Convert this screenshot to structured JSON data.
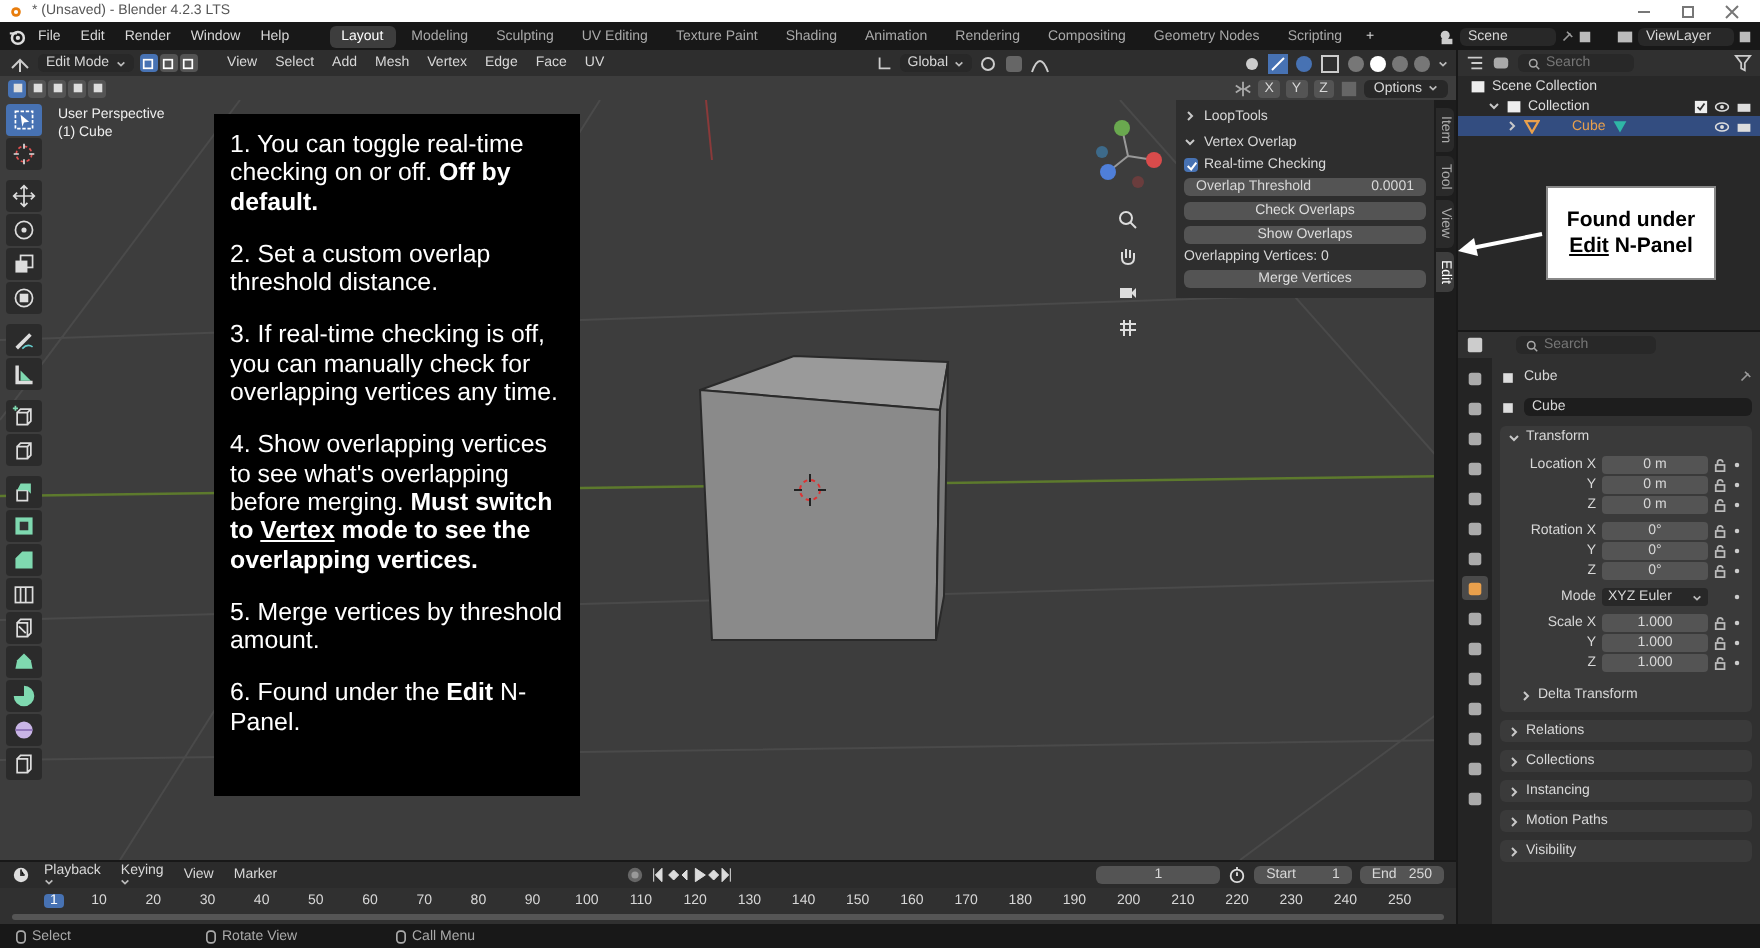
{
  "window": {
    "title": "* (Unsaved) - Blender 4.2.3 LTS"
  },
  "menu": [
    "File",
    "Edit",
    "Render",
    "Window",
    "Help"
  ],
  "workspaces": [
    {
      "label": "Layout",
      "selected": true
    },
    {
      "label": "Modeling",
      "selected": false
    },
    {
      "label": "Sculpting",
      "selected": false
    },
    {
      "label": "UV Editing",
      "selected": false
    },
    {
      "label": "Texture Paint",
      "selected": false
    },
    {
      "label": "Shading",
      "selected": false
    },
    {
      "label": "Animation",
      "selected": false
    },
    {
      "label": "Rendering",
      "selected": false
    },
    {
      "label": "Compositing",
      "selected": false
    },
    {
      "label": "Geometry Nodes",
      "selected": false
    },
    {
      "label": "Scripting",
      "selected": false
    }
  ],
  "add_workspace": "+",
  "scene": "Scene",
  "view_layer": "ViewLayer",
  "viewport_header": {
    "mode": "Edit Mode",
    "select_modes": [
      {
        "selected": true
      },
      {
        "selected": false
      },
      {
        "selected": false
      }
    ],
    "menus": [
      "View",
      "Select",
      "Add",
      "Mesh",
      "Vertex",
      "Edge",
      "Face",
      "UV"
    ],
    "orientation": "Global",
    "shading_modes": [
      {
        "selected": false
      },
      {
        "selected": true
      },
      {
        "selected": false
      },
      {
        "selected": false
      }
    ],
    "selection_ops": [
      {
        "selected": true
      },
      {
        "selected": false
      },
      {
        "selected": false
      },
      {
        "selected": false
      },
      {
        "selected": false
      }
    ],
    "mirror_axes": [
      "X",
      "Y",
      "Z"
    ],
    "options": "Options"
  },
  "viewport": {
    "view_name": "User Perspective",
    "object": "(1) Cube"
  },
  "tools": [
    {
      "selected": true
    },
    {
      "selected": false
    },
    {
      "selected": false
    },
    {
      "selected": false
    },
    {
      "selected": false
    },
    {
      "selected": false
    },
    {
      "selected": false
    },
    {
      "selected": false
    },
    {
      "selected": false
    },
    {
      "selected": false
    },
    {
      "selected": false
    },
    {
      "selected": false
    },
    {
      "selected": false
    },
    {
      "selected": false
    },
    {
      "selected": false
    },
    {
      "selected": false
    },
    {
      "selected": false
    },
    {
      "selected": false
    },
    {
      "selected": false
    }
  ],
  "instructions": [
    {
      "segments": [
        {
          "text": "1. You can toggle real-time checking on or off. ",
          "kind": "plain"
        },
        {
          "text": "Off by default.",
          "kind": "bold"
        }
      ]
    },
    {
      "segments": [
        {
          "text": "2. Set a custom overlap threshold distance.",
          "kind": "plain"
        }
      ]
    },
    {
      "segments": [
        {
          "text": "3. If real-time checking is off, you can manually check for overlapping vertices any time.",
          "kind": "plain"
        }
      ]
    },
    {
      "segments": [
        {
          "text": "4. Show overlapping vertices to see what's overlapping before merging. ",
          "kind": "plain"
        },
        {
          "text": "Must switch to ",
          "kind": "bold"
        },
        {
          "text": "Vertex",
          "kind": "underlined"
        },
        {
          "text": " mode to see the overlapping vertices.",
          "kind": "bold"
        }
      ]
    },
    {
      "segments": [
        {
          "text": "5. Merge vertices by threshold amount.",
          "kind": "plain"
        }
      ]
    },
    {
      "segments": [
        {
          "text": "6. Found under the ",
          "kind": "plain"
        },
        {
          "text": "Edit",
          "kind": "bold"
        },
        {
          "text": " N-Panel.",
          "kind": "plain"
        }
      ]
    }
  ],
  "n_panel": {
    "sections": [
      {
        "label": "LoopTools",
        "expanded": false
      },
      {
        "label": "Vertex Overlap",
        "expanded": true
      }
    ],
    "realtime": {
      "label": "Real-time Checking",
      "checked": true
    },
    "threshold": {
      "label": "Overlap Threshold",
      "value": "0.0001"
    },
    "buttons": [
      "Check Overlaps",
      "Show Overlaps"
    ],
    "count": "Overlapping Vertices: 0",
    "merge": "Merge Vertices",
    "tabs": [
      {
        "label": "Item",
        "selected": false
      },
      {
        "label": "Tool",
        "selected": false
      },
      {
        "label": "View",
        "selected": false
      },
      {
        "label": "Edit",
        "selected": true
      }
    ]
  },
  "callout": {
    "lines": [
      {
        "segments": [
          {
            "text": "Found under",
            "kind": "bold"
          }
        ]
      },
      {
        "segments": [
          {
            "text": "Edit",
            "kind": "underlined"
          },
          {
            "text": " N-Panel",
            "kind": "bold"
          }
        ]
      }
    ]
  },
  "outliner": {
    "search_placeholder": "Search",
    "items": [
      {
        "label": "Scene Collection",
        "kind": "scene_collection",
        "selected": false,
        "children": [
          {
            "label": "Collection",
            "kind": "collection",
            "selected": false,
            "expanded": true,
            "children": [
              {
                "label": "Cube",
                "kind": "mesh_object",
                "selected": true,
                "expanded": false
              }
            ]
          }
        ]
      }
    ]
  },
  "properties": {
    "search_placeholder": "Search",
    "tabs": [
      {
        "selected": false
      },
      {
        "selected": false
      },
      {
        "selected": false
      },
      {
        "selected": false
      },
      {
        "selected": false
      },
      {
        "selected": false
      },
      {
        "selected": false
      },
      {
        "selected": true
      },
      {
        "selected": false
      },
      {
        "selected": false
      },
      {
        "selected": false
      },
      {
        "selected": false
      },
      {
        "selected": false
      },
      {
        "selected": false
      },
      {
        "selected": false
      }
    ],
    "object_name": "Cube",
    "data_name": "Cube",
    "transform": {
      "label": "Transform",
      "expanded": true,
      "groups": [
        {
          "kind": "vector",
          "rows": [
            {
              "label": "Location X",
              "value": "0 m"
            },
            {
              "label": "Y",
              "value": "0 m"
            },
            {
              "label": "Z",
              "value": "0 m"
            }
          ]
        },
        {
          "kind": "vector",
          "rows": [
            {
              "label": "Rotation X",
              "value": "0°"
            },
            {
              "label": "Y",
              "value": "0°"
            },
            {
              "label": "Z",
              "value": "0°"
            }
          ]
        },
        {
          "kind": "dropdown",
          "label": "Mode",
          "value": "XYZ Euler"
        },
        {
          "kind": "vector",
          "rows": [
            {
              "label": "Scale X",
              "value": "1.000"
            },
            {
              "label": "Y",
              "value": "1.000"
            },
            {
              "label": "Z",
              "value": "1.000"
            }
          ]
        }
      ],
      "subsections": [
        {
          "label": "Delta Transform",
          "expanded": false
        }
      ]
    },
    "sections": [
      {
        "label": "Relations",
        "expanded": false
      },
      {
        "label": "Collections",
        "expanded": false
      },
      {
        "label": "Instancing",
        "expanded": false
      },
      {
        "label": "Motion Paths",
        "expanded": false
      },
      {
        "label": "Visibility",
        "expanded": false
      }
    ]
  },
  "timeline": {
    "menus": [
      "Playback",
      "Keying",
      "View",
      "Marker"
    ],
    "current_frame": "1",
    "start": {
      "label": "Start",
      "value": "1"
    },
    "end": {
      "label": "End",
      "value": "250"
    },
    "playhead": "1",
    "ticks": [
      "10",
      "20",
      "30",
      "40",
      "50",
      "60",
      "70",
      "80",
      "90",
      "100",
      "110",
      "120",
      "130",
      "140",
      "150",
      "160",
      "170",
      "180",
      "190",
      "200",
      "210",
      "220",
      "230",
      "240",
      "250"
    ]
  },
  "status_bar": [
    {
      "label": "Select"
    },
    {
      "label": "Rotate View"
    },
    {
      "label": "Call Menu"
    }
  ]
}
